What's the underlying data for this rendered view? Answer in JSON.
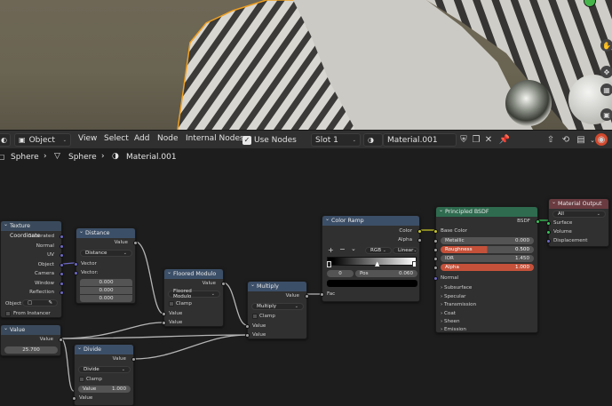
{
  "header": {
    "mode_label": "Object",
    "menus": [
      "View",
      "Select",
      "Add",
      "Node",
      "Internal Nodes"
    ],
    "use_nodes_label": "Use Nodes",
    "slot_label": "Slot 1",
    "material_name": "Material.001"
  },
  "breadcrumb": {
    "object": "Sphere",
    "mesh": "Sphere",
    "material": "Material.001"
  },
  "nodes": {
    "texcoord": {
      "title": "Texture Coordinate",
      "outputs": [
        "Generated",
        "Normal",
        "UV",
        "Object",
        "Camera",
        "Window",
        "Reflection"
      ],
      "object_label": "Object",
      "from_instancer": "From Instancer"
    },
    "distance": {
      "title": "Distance",
      "output": "Value",
      "mode": "Distance",
      "inputs": [
        "Vector",
        "Vector:"
      ],
      "vec": [
        "0.000",
        "0.000",
        "0.000"
      ]
    },
    "floored": {
      "title": "Floored Modulo",
      "output": "Value",
      "mode": "Floored Modulo",
      "clamp": "Clamp",
      "inputs": [
        "Value",
        "Value"
      ]
    },
    "multiply": {
      "title": "Multiply",
      "output": "Value",
      "mode": "Multiply",
      "clamp": "Clamp",
      "inputs": [
        "Value",
        "Value"
      ]
    },
    "value": {
      "title": "Value",
      "output": "Value",
      "amount": "25.700"
    },
    "divide": {
      "title": "Divide",
      "output": "Value",
      "mode": "Divide",
      "clamp": "Clamp",
      "input": "Value",
      "value_label": "Value",
      "value_amount": "1.000",
      "input2": "Value"
    },
    "colorramp": {
      "title": "Color Ramp",
      "outputs": [
        "Color",
        "Alpha"
      ],
      "color_mode": "RGB",
      "interp": "Linear",
      "stop_index": "0",
      "pos_label": "Pos",
      "pos_value": "0.060",
      "input": "Fac"
    },
    "bsdf": {
      "title": "Principled BSDF",
      "output": "BSDF",
      "base_color": "Base Color",
      "fields": [
        {
          "label": "Metallic",
          "value": "0.000"
        },
        {
          "label": "Roughness",
          "value": "0.500"
        },
        {
          "label": "IOR",
          "value": "1.450"
        },
        {
          "label": "Alpha",
          "value": "1.000"
        }
      ],
      "normal": "Normal",
      "panels": [
        "Subsurface",
        "Specular",
        "Transmission",
        "Coat",
        "Sheen",
        "Emission"
      ]
    },
    "output": {
      "title": "Material Output",
      "target": "All",
      "inputs": [
        "Surface",
        "Volume",
        "Displacement"
      ]
    }
  }
}
